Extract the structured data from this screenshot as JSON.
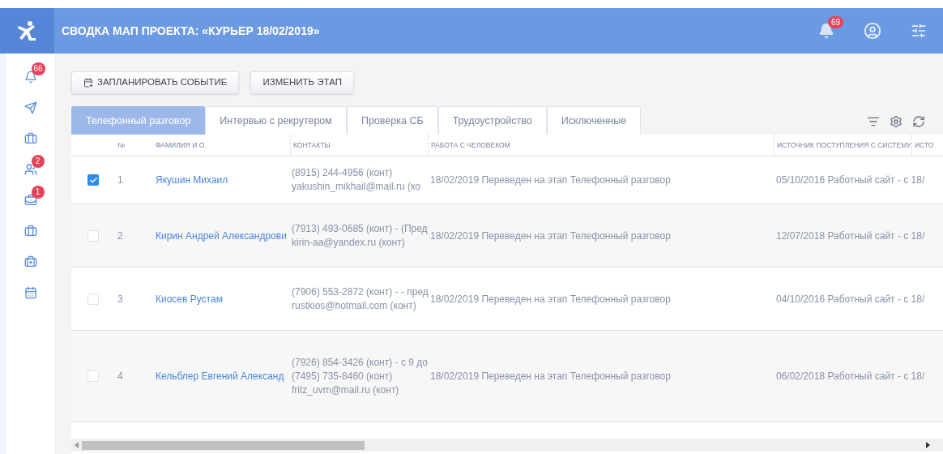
{
  "header": {
    "title": "СВОДКА МАП ПРОЕКТА: «КУРЬЕР 18/02/2019»",
    "notifications_badge": "69"
  },
  "sidebar": {
    "badges": [
      "66",
      "2",
      "1"
    ]
  },
  "toolbar": {
    "buttons": [
      "ЗАПЛАНИРОВАТЬ СОБЫТИЕ",
      "ИЗМЕНИТЬ ЭТАП"
    ]
  },
  "tabs": [
    {
      "label": "Телефонный разговор",
      "selected": true
    },
    {
      "label": "Интервью с рекрутером",
      "selected": false
    },
    {
      "label": "Проверка СБ",
      "selected": false
    },
    {
      "label": "Трудоустройство",
      "selected": false
    },
    {
      "label": "Исключенные",
      "selected": false
    }
  ],
  "table": {
    "columns": [
      "№",
      "ФАМИЛИЯ И.О.",
      "КОНТАКТЫ",
      "РАБОТА С ЧЕЛОВЕКОМ",
      "ИСТОЧНИК ПОСТУПЛЕНИЯ С СИСТЕМУ",
      "ИСТО"
    ],
    "rows": [
      {
        "selected": true,
        "number": "1",
        "name": "Якушин Михаил",
        "contacts": [
          "(8915) 244-4956 (конт)",
          "yakushin_mikhail@mail.ru (ко"
        ],
        "work": "18/02/2019 Переведен на этап Телефонный разговор",
        "source": "05/10/2016 Работный сайт - с 18/"
      },
      {
        "selected": false,
        "number": "2",
        "name": "Кирин Андрей Александрови",
        "contacts": [
          "(7913) 493-0685 (конт) - (Пред",
          "kirin-aa@yandex.ru (конт)"
        ],
        "work": "18/02/2019 Переведен на этап Телефонный разговор",
        "source": "12/07/2018 Работный сайт - с 18/"
      },
      {
        "selected": false,
        "number": "3",
        "name": "Киосев Рустам",
        "contacts": [
          "(7906) 553-2872 (конт) - - пред",
          "rustkios@hotmail.com (конт)"
        ],
        "work": "18/02/2019 Переведен на этап Телефонный разговор",
        "source": "04/10/2016 Работный сайт - с 18/"
      },
      {
        "selected": false,
        "number": "4",
        "name": "Кельблер Евгений Александ",
        "contacts": [
          "(7926) 854-3426 (конт) - с 9 до",
          "(7495) 735-8460 (конт)",
          "fritz_uvm@mail.ru (конт)"
        ],
        "work": "18/02/2019 Переведен на этап Телефонный разговор",
        "source": "06/02/2018 Работный сайт - с 18/"
      }
    ]
  }
}
